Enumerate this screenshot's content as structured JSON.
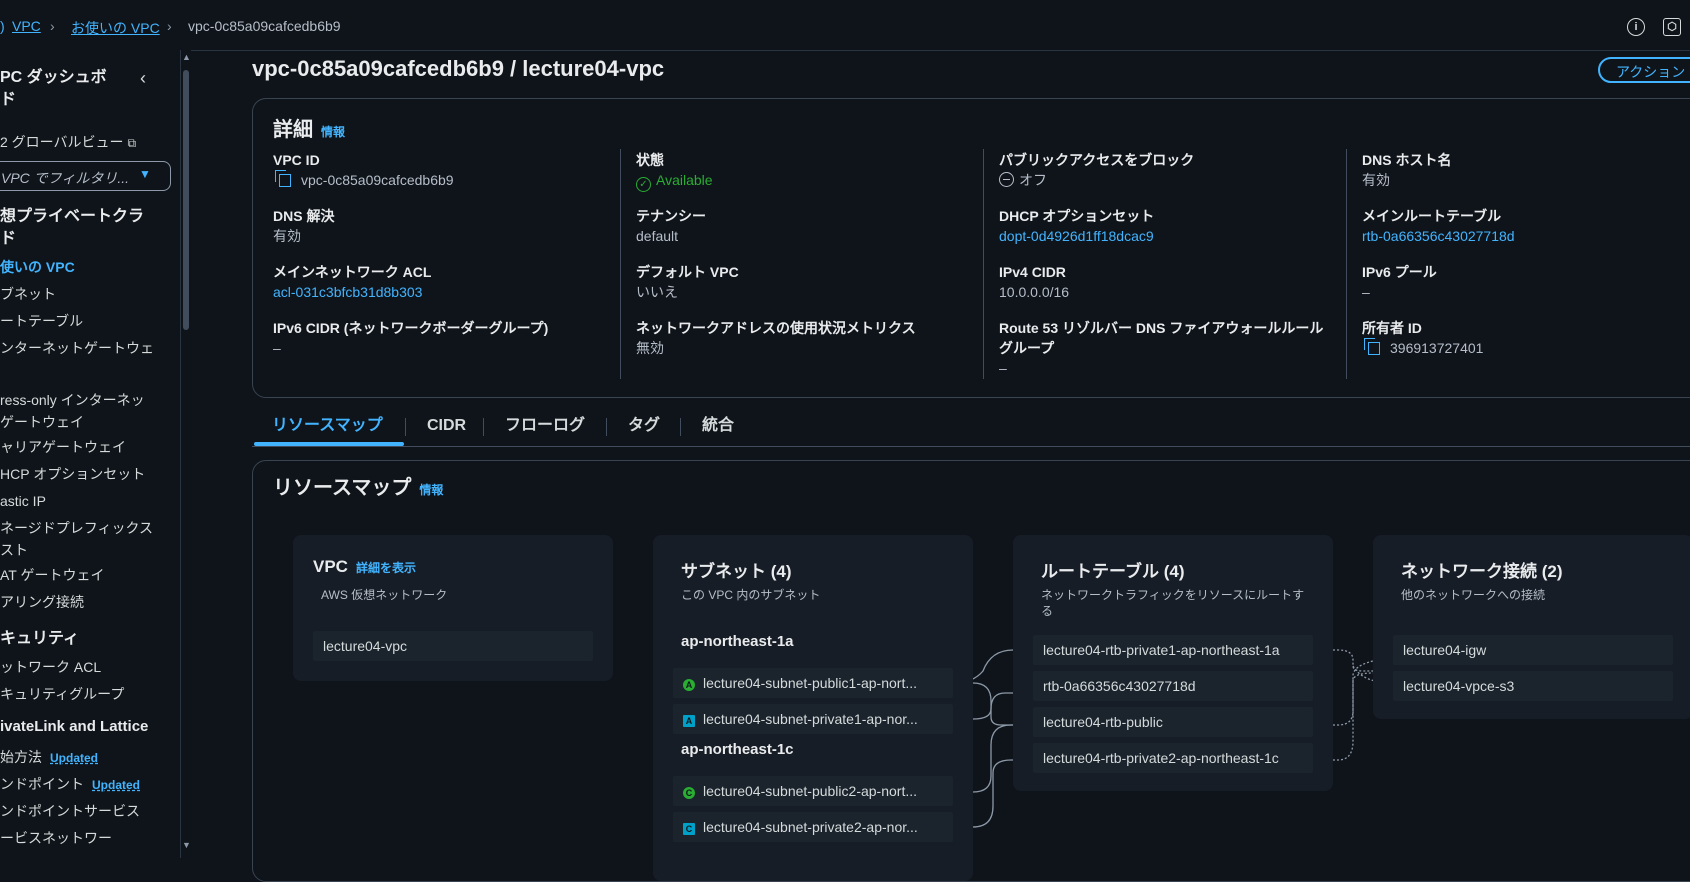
{
  "breadcrumb": {
    "items": [
      "VPC",
      "お使いの VPC",
      "vpc-0c85a09cafcedb6b9"
    ]
  },
  "top_icons": [
    "info-icon",
    "settings-icon"
  ],
  "sidebar": {
    "title": "VPC ダッシュボード",
    "title_line1": "PC ダッシュボ",
    "title_line2": "ド",
    "global_view": "2 グローバルビュー",
    "filter_placeholder": "VPC でフィルタリ...",
    "section_vpc_line1": "想プライベートクラ",
    "section_vpc_line2": "ド",
    "items": [
      "使いの VPC",
      "ブネット",
      "ートテーブル",
      "ンターネットゲートウェ",
      "ress-only インターネッ",
      "ゲートウェイ",
      "ャリアゲートウェイ",
      "HCP オプションセット",
      "astic IP",
      "ネージドプレフィックス",
      "スト",
      "AT ゲートウェイ",
      "アリング接続"
    ],
    "section_security": "キュリティ",
    "security_items": [
      "ットワーク ACL",
      "キュリティグループ"
    ],
    "section_privatelink": "ivateLink and Lattice",
    "privatelink_items": [
      "始方法",
      "ンドポイント",
      "ンドポイントサービス",
      "ービスネットワー"
    ],
    "updated_badge": "Updated"
  },
  "page": {
    "title": "vpc-0c85a09cafcedb6b9 / lecture04-vpc",
    "actions_label": "アクション ▼"
  },
  "details": {
    "heading": "詳細",
    "info": "情報",
    "col1": [
      {
        "label": "VPC ID",
        "value": "vpc-0c85a09cafcedb6b9"
      },
      {
        "label": "DNS 解決",
        "value": "有効"
      },
      {
        "label": "メインネットワーク ACL",
        "value": "acl-031c3bfcb31d8b303"
      },
      {
        "label": "IPv6 CIDR (ネットワークボーダーグループ)",
        "value": "–"
      }
    ],
    "col2": [
      {
        "label": "状態",
        "value": "Available"
      },
      {
        "label": "テナンシー",
        "value": "default"
      },
      {
        "label": "デフォルト VPC",
        "value": "いいえ"
      },
      {
        "label": "ネットワークアドレスの使用状況メトリクス",
        "value": "無効"
      }
    ],
    "col3": [
      {
        "label": "パブリックアクセスをブロック",
        "value": "オフ"
      },
      {
        "label": "DHCP オプションセット",
        "value": "dopt-0d4926d1ff18dcac9"
      },
      {
        "label": "IPv4 CIDR",
        "value": "10.0.0.0/16"
      },
      {
        "label": "Route 53 リゾルバー DNS ファイアウォールルール",
        "label_line2": "グループ",
        "value": "–"
      }
    ],
    "col4": [
      {
        "label": "DNS ホスト名",
        "value": "有効"
      },
      {
        "label": "メインルートテーブル",
        "value": "rtb-0a66356c43027718d"
      },
      {
        "label": "IPv6 プール",
        "value": "–"
      },
      {
        "label": "所有者 ID",
        "value": "396913727401"
      }
    ]
  },
  "tabs": [
    "リソースマップ",
    "CIDR",
    "フローログ",
    "タグ",
    "統合"
  ],
  "resource_map": {
    "heading": "リソースマップ",
    "info": "情報",
    "vpc": {
      "title": "VPC",
      "link": "詳細を表示",
      "desc": "AWS 仮想ネットワーク",
      "item": "lecture04-vpc"
    },
    "subnets": {
      "title": "サブネット (4)",
      "desc": "この VPC 内のサブネット",
      "az1": "ap-northeast-1a",
      "az2": "ap-northeast-1c",
      "items": [
        {
          "badge": "A",
          "name": "lecture04-subnet-public1-ap-nort...",
          "type": "public"
        },
        {
          "badge": "A",
          "name": "lecture04-subnet-private1-ap-nor...",
          "type": "private"
        },
        {
          "badge": "C",
          "name": "lecture04-subnet-public2-ap-nort...",
          "type": "public"
        },
        {
          "badge": "C",
          "name": "lecture04-subnet-private2-ap-nor...",
          "type": "private"
        }
      ]
    },
    "route_tables": {
      "title": "ルートテーブル (4)",
      "desc": "ネットワークトラフィックをリソースにルートする",
      "items": [
        "lecture04-rtb-private1-ap-northeast-1a",
        "rtb-0a66356c43027718d",
        "lecture04-rtb-public",
        "lecture04-rtb-private2-ap-northeast-1c"
      ]
    },
    "connections": {
      "title": "ネットワーク接続 (2)",
      "desc": "他のネットワークへの接続",
      "items": [
        "lecture04-igw",
        "lecture04-vpce-s3"
      ]
    }
  },
  "colors": {
    "background": "#0f141a",
    "link": "#42b4ff",
    "available": "#29ad32",
    "card": "#161d26"
  }
}
